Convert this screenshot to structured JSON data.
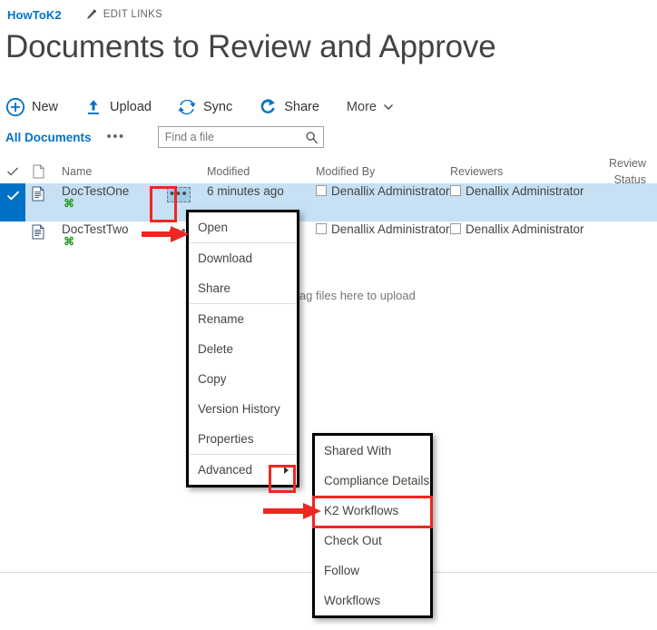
{
  "topbar": {
    "site_link": "HowToK2",
    "edit_links_label": "EDIT LINKS",
    "link_color": "#0072c6"
  },
  "page_title": "Documents to Review and Approve",
  "commandbar": {
    "items": [
      {
        "label": "New",
        "icon": "plus-circle-icon"
      },
      {
        "label": "Upload",
        "icon": "upload-arrow-icon"
      },
      {
        "label": "Sync",
        "icon": "sync-icon"
      },
      {
        "label": "Share",
        "icon": "share-icon"
      }
    ],
    "more_label": "More"
  },
  "viewrow": {
    "view_name": "All Documents",
    "ellipsis": "•••",
    "search_placeholder": "Find a file",
    "search_value": ""
  },
  "list": {
    "headers": {
      "select_all": "check-icon",
      "type": "document-type-icon",
      "name": "Name",
      "modified": "Modified",
      "modified_by": "Modified By",
      "reviewers": "Reviewers",
      "review_status": "Review Status"
    },
    "rows": [
      {
        "selected": true,
        "name": "DocTestOne",
        "new_badge": "⌘",
        "modified": "6 minutes ago",
        "modified_by": "Denallix Administrator",
        "reviewers": "Denallix Administrator",
        "review_status": "",
        "dots": "•••",
        "dots_active": true
      },
      {
        "selected": false,
        "name": "DocTestTwo",
        "new_badge": "⌘",
        "modified": "",
        "modified_by": "Denallix Administrator",
        "reviewers": "Denallix Administrator",
        "review_status": "",
        "dots": "•••",
        "dots_active": false
      }
    ],
    "drag_hint": "Drag files here to upload"
  },
  "context_menu": {
    "items": [
      {
        "label": "Open",
        "sep_after": true
      },
      {
        "label": "Download",
        "sep_after": false
      },
      {
        "label": "Share",
        "sep_after": true
      },
      {
        "label": "Rename",
        "sep_after": false
      },
      {
        "label": "Delete",
        "sep_after": false
      },
      {
        "label": "Copy",
        "sep_after": false
      },
      {
        "label": "Version History",
        "sep_after": false
      },
      {
        "label": "Properties",
        "sep_after": true
      },
      {
        "label": "Advanced",
        "sep_after": false,
        "has_submenu": true
      }
    ]
  },
  "submenu": {
    "items": [
      {
        "label": "Shared With"
      },
      {
        "label": "Compliance Details"
      },
      {
        "label": "K2 Workflows",
        "highlighted": true
      },
      {
        "label": "Check Out"
      },
      {
        "label": "Follow"
      },
      {
        "label": "Workflows"
      }
    ]
  },
  "annotations": {
    "highlight_color": "#ee2722",
    "boxes": [
      "row-ellipsis-button",
      "advanced-submenu-arrow",
      "k2-workflows-item"
    ],
    "arrows": [
      "arrow-to-context-menu",
      "arrow-to-k2-workflows"
    ]
  }
}
